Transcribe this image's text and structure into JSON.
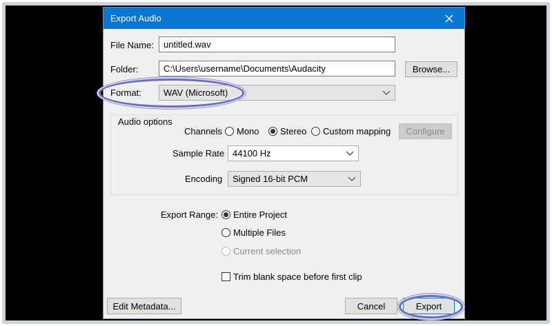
{
  "dialog": {
    "title": "Export Audio",
    "file_name_label": "File Name:",
    "file_name_value": "untitled.wav",
    "folder_label": "Folder:",
    "folder_value": "C:\\Users\\username\\Documents\\Audacity",
    "browse_label": "Browse...",
    "format_label": "Format:",
    "format_value": "WAV (Microsoft)"
  },
  "audio_options": {
    "title": "Audio options",
    "channels_label": "Channels",
    "channel_options": [
      {
        "label": "Mono",
        "checked": false
      },
      {
        "label": "Stereo",
        "checked": true
      },
      {
        "label": "Custom mapping",
        "checked": false
      }
    ],
    "configure_label": "Configure",
    "sample_rate_label": "Sample Rate",
    "sample_rate_value": "44100 Hz",
    "encoding_label": "Encoding",
    "encoding_value": "Signed 16-bit PCM"
  },
  "export_range": {
    "label": "Export Range:",
    "options": [
      {
        "label": "Entire Project",
        "checked": true,
        "enabled": true
      },
      {
        "label": "Multiple Files",
        "checked": false,
        "enabled": true
      },
      {
        "label": "Current selection",
        "checked": false,
        "enabled": false
      }
    ]
  },
  "trim": {
    "label": "Trim blank space before first clip",
    "checked": false
  },
  "footer": {
    "edit_metadata_label": "Edit Metadata...",
    "cancel_label": "Cancel",
    "export_label": "Export"
  },
  "colors": {
    "titlebar": "#0a78d2",
    "highlight_ring": "#6b6fb8",
    "dialog_bg": "#f0f0f0"
  }
}
